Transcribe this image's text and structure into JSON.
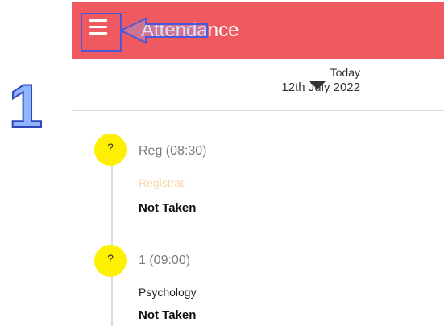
{
  "annotation": {
    "step_number": "1"
  },
  "header": {
    "title": "Attendance",
    "menu_icon": "hamburger-menu-icon"
  },
  "date_selector": {
    "label": "Today",
    "date": "12th July 2022",
    "icon": "caret-down-icon"
  },
  "periods": [
    {
      "indicator": "?",
      "title": "Reg (08:30)",
      "subject": "Registrati",
      "status": "Not Taken"
    },
    {
      "indicator": "?",
      "title": "1 (09:00)",
      "subject": "Psychology",
      "status": "Not Taken"
    }
  ],
  "colors": {
    "header": "#ee5a5f",
    "indicator": "#ffef00",
    "annotation": "#4b59d8",
    "step_number": "#8fb5ff",
    "subject_faded": "#f7d8a6"
  }
}
